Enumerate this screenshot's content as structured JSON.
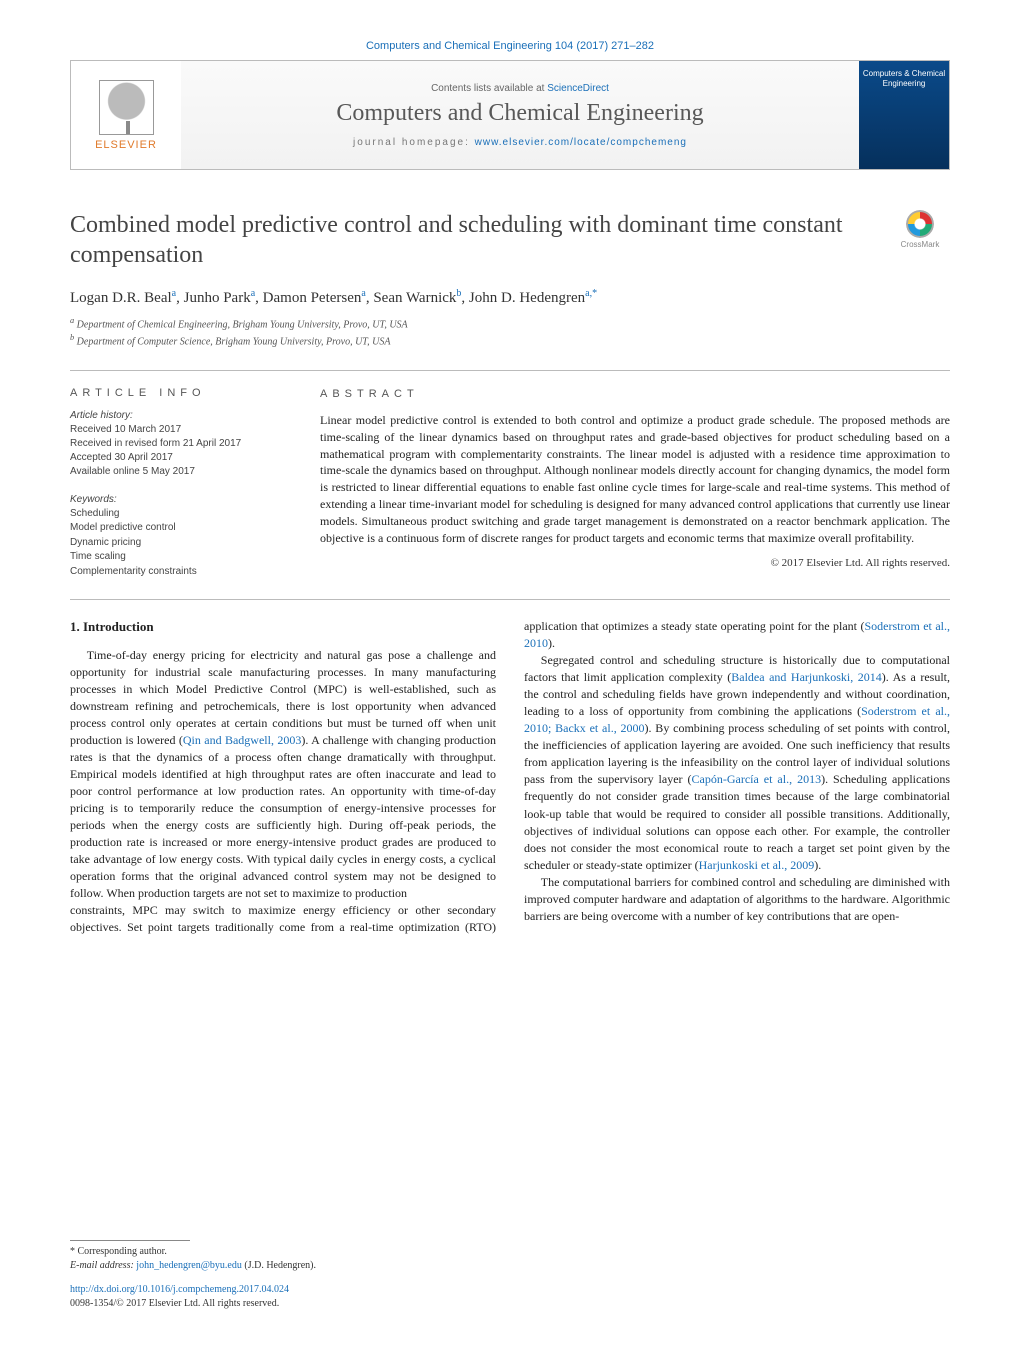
{
  "running_head": "Computers and Chemical Engineering 104 (2017) 271–282",
  "masthead": {
    "publisher": "ELSEVIER",
    "contents_prefix": "Contents lists available at ",
    "contents_link": "ScienceDirect",
    "journal": "Computers and Chemical Engineering",
    "homepage_label": "journal homepage: ",
    "homepage_url": "www.elsevier.com/locate/compchemeng",
    "cover_text": "Computers & Chemical Engineering"
  },
  "crossmark_label": "CrossMark",
  "title": "Combined model predictive control and scheduling with dominant time constant compensation",
  "authors_html": "Logan D.R. Beal<sup>a</sup>, Junho Park<sup>a</sup>, Damon Petersen<sup>a</sup>, Sean Warnick<sup>b</sup>, John D. Hedengren<sup>a,*</sup>",
  "affiliations": [
    "a Department of Chemical Engineering, Brigham Young University, Provo, UT, USA",
    "b Department of Computer Science, Brigham Young University, Provo, UT, USA"
  ],
  "article_info": {
    "heading": "ARTICLE INFO",
    "history_label": "Article history:",
    "history": [
      "Received 10 March 2017",
      "Received in revised form 21 April 2017",
      "Accepted 30 April 2017",
      "Available online 5 May 2017"
    ],
    "keywords_label": "Keywords:",
    "keywords": [
      "Scheduling",
      "Model predictive control",
      "Dynamic pricing",
      "Time scaling",
      "Complementarity constraints"
    ]
  },
  "abstract": {
    "heading": "ABSTRACT",
    "text": "Linear model predictive control is extended to both control and optimize a product grade schedule. The proposed methods are time-scaling of the linear dynamics based on throughput rates and grade-based objectives for product scheduling based on a mathematical program with complementarity constraints. The linear model is adjusted with a residence time approximation to time-scale the dynamics based on throughput. Although nonlinear models directly account for changing dynamics, the model form is restricted to linear differential equations to enable fast online cycle times for large-scale and real-time systems. This method of extending a linear time-invariant model for scheduling is designed for many advanced control applications that currently use linear models. Simultaneous product switching and grade target management is demonstrated on a reactor benchmark application. The objective is a continuous form of discrete ranges for product targets and economic terms that maximize overall profitability.",
    "copyright": "© 2017 Elsevier Ltd. All rights reserved."
  },
  "section1": {
    "heading": "1. Introduction",
    "p1": "Time-of-day energy pricing for electricity and natural gas pose a challenge and opportunity for industrial scale manufacturing processes. In many manufacturing processes in which Model Predictive Control (MPC) is well-established, such as downstream refining and petrochemicals, there is lost opportunity when advanced process control only operates at certain conditions but must be turned off when unit production is lowered (",
    "p1_link": "Qin and Badgwell, 2003",
    "p1b": "). A challenge with changing production rates is that the dynamics of a process often change dramatically with throughput. Empirical models identified at high throughput rates are often inaccurate and lead to poor control performance at low production rates. An opportunity with time-of-day pricing is to temporarily reduce the consumption of energy-intensive processes for periods when the energy costs are sufficiently high. During off-peak periods, the production rate is increased or more energy-intensive product grades are produced to take advantage of low energy costs. With typical daily cycles in energy costs, a cyclical operation forms that the original advanced control system may not be designed to follow. When production targets are not set to maximize to production",
    "p2a": "constraints, MPC may switch to maximize energy efficiency or other secondary objectives. Set point targets traditionally come from a real-time optimization (RTO) application that optimizes a steady state operating point for the plant (",
    "p2a_link": "Soderstrom et al., 2010",
    "p2a_end": ").",
    "p2": "Segregated control and scheduling structure is historically due to computational factors that limit application complexity (",
    "p2_link1": "Baldea and Harjunkoski, 2014",
    "p2_mid": "). As a result, the control and scheduling fields have grown independently and without coordination, leading to a loss of opportunity from combining the applications (",
    "p2_link2": "Soderstrom et al., 2010; Backx et al., 2000",
    "p2c": "). By combining process scheduling of set points with control, the inefficiencies of application layering are avoided. One such inefficiency that results from application layering is the infeasibility on the control layer of individual solutions pass from the supervisory layer (",
    "p2_link3": "Capón-García et al., 2013",
    "p2d": "). Scheduling applications frequently do not consider grade transition times because of the large combinatorial look-up table that would be required to consider all possible transitions. Additionally, objectives of individual solutions can oppose each other. For example, the controller does not consider the most economical route to reach a target set point given by the scheduler or steady-state optimizer (",
    "p2_link4": "Harjunkoski et al., 2009",
    "p2e": ").",
    "p3": "The computational barriers for combined control and scheduling are diminished with improved computer hardware and adaptation of algorithms to the hardware. Algorithmic barriers are being overcome with a number of key contributions that are open-"
  },
  "footer": {
    "corr_label": "* Corresponding author.",
    "email_label": "E-mail address: ",
    "email": "john_hedengren@byu.edu",
    "email_name": " (J.D. Hedengren).",
    "doi": "http://dx.doi.org/10.1016/j.compchemeng.2017.04.024",
    "issn_line": "0098-1354/© 2017 Elsevier Ltd. All rights reserved."
  }
}
